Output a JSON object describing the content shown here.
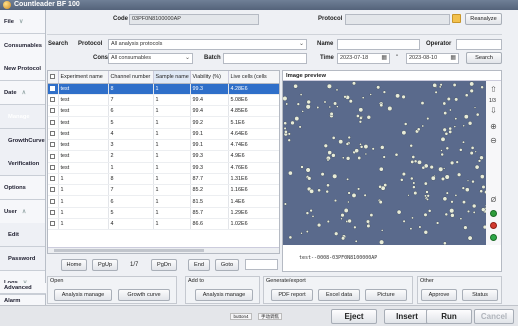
{
  "app": {
    "title": "Countleader BF 100"
  },
  "sidebar": {
    "items": [
      {
        "label": "File",
        "chevron": "∨"
      },
      {
        "label": "Consumables"
      },
      {
        "label": "New Protocol"
      },
      {
        "label": "Date",
        "chevron": "∧"
      },
      {
        "label": "Manage"
      },
      {
        "label": "GrowthCurve"
      },
      {
        "label": "Verification"
      },
      {
        "label": "Options"
      },
      {
        "label": "User",
        "chevron": "∧"
      },
      {
        "label": "Edit"
      },
      {
        "label": "Password"
      },
      {
        "label": "Logs",
        "chevron": "∨"
      },
      {
        "label": "Alarm"
      },
      {
        "label": "Advanced"
      }
    ],
    "scroll_left": "<",
    "scroll_right": ">"
  },
  "topbar": {
    "code_label": "Code",
    "code_value": "03PF0N8100000AP",
    "protocol_label": "Protocol",
    "protocol_value": "",
    "reanalyze_label": "Reanalyze"
  },
  "search": {
    "search_label": "Search",
    "protocol_label": "Protocol",
    "protocol_value": "All analysis protocols",
    "name_label": "Name",
    "name_value": "",
    "operator_label": "Operator",
    "operator_value": "",
    "consumable_label": "Consumable",
    "consumable_value": "All consumables",
    "batch_label": "Batch",
    "batch_value": "",
    "time_label": "Time",
    "time_from": "2023-07-18",
    "time_to": "2023-08-10",
    "time_sep": "-",
    "search_button": "Search"
  },
  "table": {
    "columns": [
      "",
      "Experiment name",
      "Channel number",
      "Sample name",
      "Viability (%)",
      "Live cells (cells"
    ],
    "rows": [
      [
        "test",
        "8",
        "1",
        "99.3",
        "4.28E6"
      ],
      [
        "test",
        "7",
        "1",
        "99.4",
        "5.08E6"
      ],
      [
        "test",
        "6",
        "1",
        "99.4",
        "4.85E6"
      ],
      [
        "test",
        "5",
        "1",
        "99.2",
        "5.1E6"
      ],
      [
        "test",
        "4",
        "1",
        "99.1",
        "4.64E6"
      ],
      [
        "test",
        "3",
        "1",
        "99.1",
        "4.74E6"
      ],
      [
        "test",
        "2",
        "1",
        "99.3",
        "4.9E6"
      ],
      [
        "test",
        "1",
        "1",
        "99.3",
        "4.76E6"
      ],
      [
        "1",
        "8",
        "1",
        "87.7",
        "1.31E6"
      ],
      [
        "1",
        "7",
        "1",
        "85.2",
        "1.16E6"
      ],
      [
        "1",
        "6",
        "1",
        "81.5",
        "1.4E6"
      ],
      [
        "1",
        "5",
        "1",
        "85.7",
        "1.29E6"
      ],
      [
        "1",
        "4",
        "1",
        "86.6",
        "1.02E6"
      ]
    ],
    "selected_row": 0
  },
  "pager": {
    "home": "Home",
    "pgup": "PgUp",
    "page": "1/7",
    "pgdn": "PgDn",
    "end": "End",
    "goto": "Goto",
    "goto_value": ""
  },
  "preview": {
    "title": "Image preview",
    "caption": "test--0008-03PF0N8100000AP",
    "page_indicator": "1/3",
    "bg_color": "#5a6a8c",
    "cell_color": "#e8ecd8"
  },
  "bottom": {
    "open": {
      "title": "Open",
      "buttons": [
        "Analysis manage",
        "Growth curve"
      ]
    },
    "addto": {
      "title": "Add to",
      "buttons": [
        "Analysis manage"
      ]
    },
    "export": {
      "title": "Generate/export",
      "buttons": [
        "PDF report",
        "Excel data",
        "Picture"
      ]
    },
    "other": {
      "title": "Other",
      "buttons": [
        "Approve",
        "Status"
      ]
    }
  },
  "statusbar": {
    "button4": "button4",
    "btn_cn": "手动调焦",
    "eject": "Eject",
    "insert": "Insert",
    "run": "Run",
    "cancel": "Cancel"
  }
}
